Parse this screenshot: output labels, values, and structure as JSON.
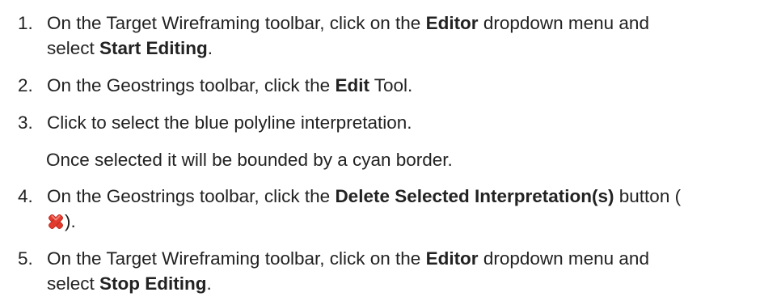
{
  "steps": [
    {
      "number": "1.",
      "line1": [
        {
          "t": "On the Target Wireframing toolbar, click on the "
        },
        {
          "t": "Editor",
          "b": true
        },
        {
          "t": " dropdown menu and"
        }
      ],
      "line2": [
        {
          "t": "select "
        },
        {
          "t": "Start Editing",
          "b": true
        },
        {
          "t": "."
        }
      ]
    },
    {
      "number": "2.",
      "line1": [
        {
          "t": "On the Geostrings toolbar, click the "
        },
        {
          "t": "Edit",
          "b": true
        },
        {
          "t": " Tool."
        }
      ]
    },
    {
      "number": "3.",
      "line1": [
        {
          "t": "Click to select the blue polyline interpretation."
        }
      ]
    },
    {
      "number": "4.",
      "line1": [
        {
          "t": "On the Geostrings toolbar, click the "
        },
        {
          "t": "Delete Selected Interpretation(s)",
          "b": true
        },
        {
          "t": " button ("
        }
      ],
      "line2": [
        {
          "icon": "delete-x-icon"
        },
        {
          "t": ")."
        }
      ]
    },
    {
      "number": "5.",
      "line1": [
        {
          "t": "On the Target Wireframing toolbar, click on the "
        },
        {
          "t": "Editor",
          "b": true
        },
        {
          "t": " dropdown menu and"
        }
      ],
      "line2": [
        {
          "t": "select "
        },
        {
          "t": "Stop Editing",
          "b": true
        },
        {
          "t": "."
        }
      ]
    }
  ],
  "note": "Once selected it will be bounded by a cyan border.",
  "colors": {
    "text": "#222222",
    "icon_fill": "#e23b2e",
    "icon_highlight": "#f7938a"
  }
}
